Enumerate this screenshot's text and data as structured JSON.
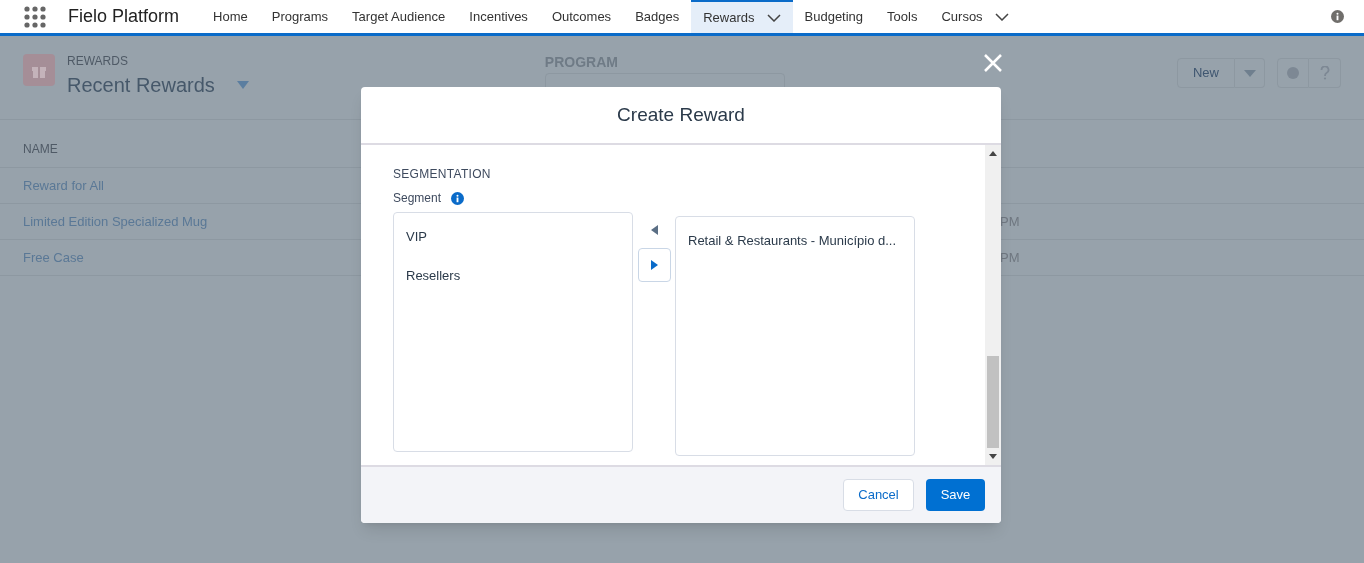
{
  "app_name": "Fielo Platform",
  "nav": [
    {
      "label": "Home",
      "selected": false,
      "dropdown": false
    },
    {
      "label": "Programs",
      "selected": false,
      "dropdown": false
    },
    {
      "label": "Target Audience",
      "selected": false,
      "dropdown": false
    },
    {
      "label": "Incentives",
      "selected": false,
      "dropdown": false
    },
    {
      "label": "Outcomes",
      "selected": false,
      "dropdown": false
    },
    {
      "label": "Badges",
      "selected": false,
      "dropdown": false
    },
    {
      "label": "Rewards",
      "selected": true,
      "dropdown": true
    },
    {
      "label": "Budgeting",
      "selected": false,
      "dropdown": false
    },
    {
      "label": "Tools",
      "selected": false,
      "dropdown": false
    },
    {
      "label": "Cursos",
      "selected": false,
      "dropdown": true
    }
  ],
  "page": {
    "object": "REWARDS",
    "list_view": "Recent Rewards",
    "program_label": "PROGRAM",
    "new_button": "New"
  },
  "table": {
    "columns": [
      "NAME"
    ],
    "rows": [
      {
        "name": "Reward for All"
      },
      {
        "name": "Limited Edition Specialized Mug",
        "column_2": "PM"
      },
      {
        "name": "Free Case",
        "column_2": "PM"
      }
    ]
  },
  "modal": {
    "title": "Create Reward",
    "section": "SEGMENTATION",
    "field_label": "Segment",
    "available": [
      "VIP",
      "Resellers"
    ],
    "chosen": [
      "Retail & Restaurants - Município d..."
    ],
    "buttons": {
      "cancel": "Cancel",
      "save": "Save"
    }
  }
}
